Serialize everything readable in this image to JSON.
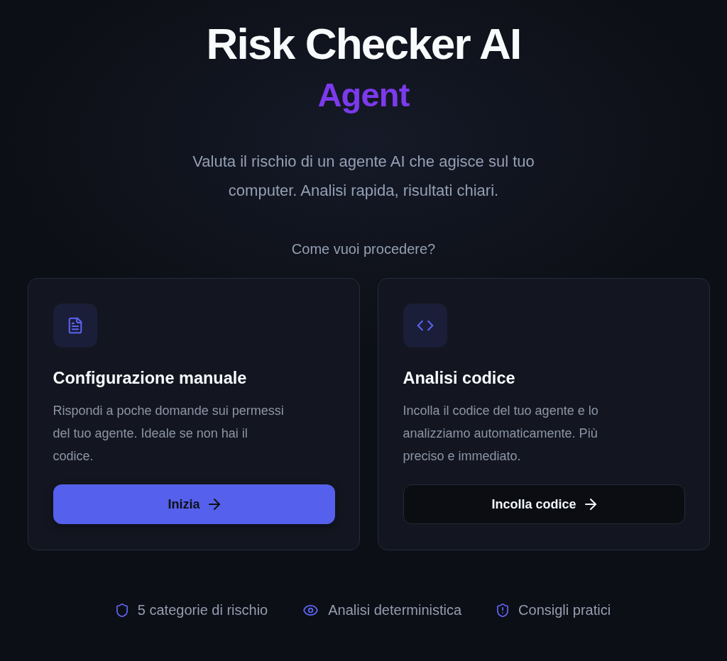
{
  "header": {
    "title": "Risk Checker AI",
    "subtitle": "Agent",
    "description": "Valuta il rischio di un agente AI che agisce sul tuo computer. Analisi rapida, risultati chiari."
  },
  "prompt": "Come vuoi procedere?",
  "options": [
    {
      "title": "Configurazione manuale",
      "description": "Rispondi a poche domande sui permessi del tuo agente. Ideale se non hai il codice.",
      "button": {
        "label": "Inizia",
        "kind": "primary"
      }
    },
    {
      "title": "Analisi codice",
      "description": "Incolla il codice del tuo agente e lo analizziamo automaticamente. Più preciso e immediato.",
      "button": {
        "label": "Incolla codice",
        "kind": "secondary"
      }
    }
  ],
  "features": [
    "5 categorie di rischio",
    "Analisi deterministica",
    "Consigli pratici"
  ]
}
